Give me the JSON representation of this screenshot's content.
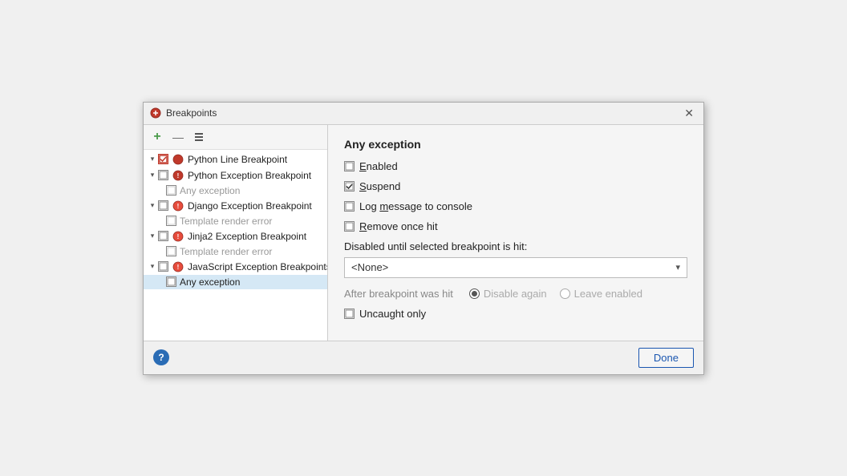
{
  "window": {
    "title": "Breakpoints",
    "close_label": "✕"
  },
  "toolbar": {
    "add_label": "+",
    "remove_label": "—",
    "settings_label": "⚙"
  },
  "tree": {
    "items": [
      {
        "id": "python-line",
        "label": "Python Line Breakpoint",
        "level": 1,
        "has_chevron": true,
        "chevron_open": true,
        "checkbox": "partial",
        "icon": "python-line"
      },
      {
        "id": "python-exc",
        "label": "Python Exception Breakpoint",
        "level": 1,
        "has_chevron": true,
        "chevron_open": true,
        "checkbox": "unchecked",
        "icon": "python-exc"
      },
      {
        "id": "any-exc-1",
        "label": "Any exception",
        "level": 2,
        "has_chevron": false,
        "checkbox": "unchecked",
        "icon": null,
        "muted": true
      },
      {
        "id": "django-exc",
        "label": "Django Exception Breakpoint",
        "level": 1,
        "has_chevron": true,
        "chevron_open": true,
        "checkbox": "unchecked",
        "icon": "django-exc"
      },
      {
        "id": "template-err-1",
        "label": "Template render error",
        "level": 2,
        "has_chevron": false,
        "checkbox": "unchecked",
        "icon": null,
        "muted": true
      },
      {
        "id": "jinja-exc",
        "label": "Jinja2 Exception Breakpoint",
        "level": 1,
        "has_chevron": true,
        "chevron_open": true,
        "checkbox": "unchecked",
        "icon": "jinja-exc"
      },
      {
        "id": "template-err-2",
        "label": "Template render error",
        "level": 2,
        "has_chevron": false,
        "checkbox": "unchecked",
        "icon": null,
        "muted": true
      },
      {
        "id": "js-exc",
        "label": "JavaScript Exception Breakpoints",
        "level": 1,
        "has_chevron": true,
        "chevron_open": true,
        "checkbox": "unchecked",
        "icon": "js-exc"
      },
      {
        "id": "any-exc-2",
        "label": "Any exception",
        "level": 2,
        "has_chevron": false,
        "checkbox": "unchecked",
        "icon": null,
        "selected": true
      }
    ]
  },
  "detail": {
    "title": "Any exception",
    "options": [
      {
        "id": "enabled",
        "label": "Enabled",
        "underline_char": "E",
        "checked": false
      },
      {
        "id": "suspend",
        "label": "Suspend",
        "underline_char": "S",
        "checked": true
      },
      {
        "id": "log_message",
        "label": "Log message to console",
        "underline_char": "m",
        "checked": false
      },
      {
        "id": "remove_once",
        "label": "Remove once hit",
        "underline_char": "R",
        "checked": false
      }
    ],
    "disabled_label": "Disabled until selected breakpoint is hit:",
    "dropdown_value": "<None>",
    "after_label": "After breakpoint was hit",
    "radio_options": [
      {
        "id": "disable_again",
        "label": "Disable again",
        "selected": true
      },
      {
        "id": "leave_enabled",
        "label": "Leave enabled",
        "selected": false
      }
    ],
    "uncaught_label": "Uncaught only",
    "uncaught_checked": false
  },
  "footer": {
    "help_label": "?",
    "done_label": "Done"
  }
}
